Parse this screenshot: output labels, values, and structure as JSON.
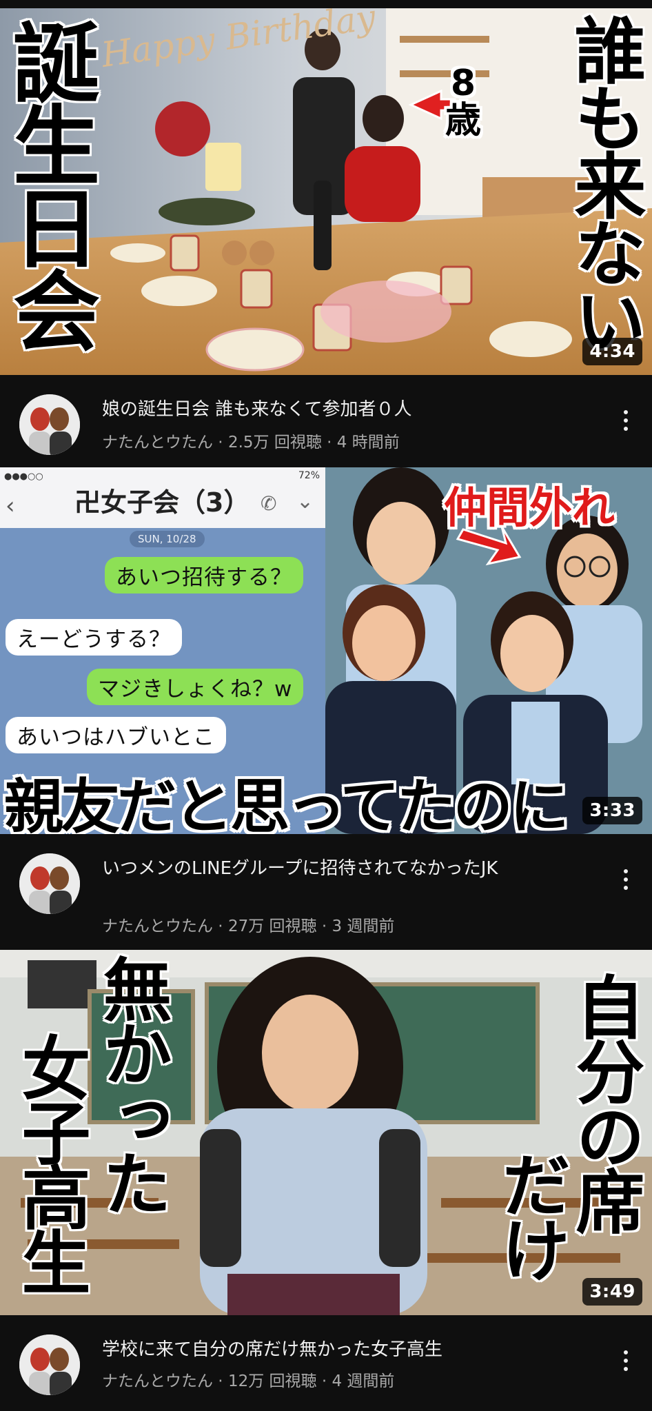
{
  "videos": [
    {
      "thumb_text_left": "誕生日会",
      "thumb_text_right": "誰も来ない",
      "thumb_age_label": "8\n歳",
      "thumb_banner": "Happy Birthday",
      "duration": "4:34",
      "title": "娘の誕生日会 誰も来なくて参加者０人",
      "channel": "ナたんとウたん",
      "views": "2.5万 回視聴",
      "age": "4 時間前"
    },
    {
      "chat_group_title": "卍女子会（3）",
      "chat_date": "SUN, 10/28",
      "chat_status_battery": "72%",
      "chat_messages": [
        {
          "side": "right",
          "text": "あいつ招待する？"
        },
        {
          "side": "left",
          "text": "えーどうする？"
        },
        {
          "side": "right",
          "text": "マジきしょくね？w"
        },
        {
          "side": "left",
          "text": "あいつはハブいとこ"
        }
      ],
      "thumb_tag": "仲間外れ",
      "thumb_caption": "親友だと思ってたのに",
      "duration": "3:33",
      "title": "いつメンのLINEグループに招待されてなかったJK",
      "channel": "ナたんとウたん",
      "views": "27万 回視聴",
      "age": "3 週間前"
    },
    {
      "thumb_text_left_a": "無かった",
      "thumb_text_left_b": "女子高生",
      "thumb_text_right_a": "自分の席",
      "thumb_text_right_b": "だけ",
      "duration": "3:49",
      "title": "学校に来て自分の席だけ無かった女子高生",
      "channel": "ナたんとウたん",
      "views": "12万 回視聴",
      "age": "4 週間前"
    }
  ],
  "separator": " · ",
  "colors": {
    "background": "#0f0f0f",
    "text_primary": "#f1f1f1",
    "text_secondary": "#aaaaaa",
    "line_green": "#8de055"
  },
  "icons": [
    "more-vert-icon",
    "phone-icon",
    "chevron-down-icon",
    "back-chevron-icon"
  ]
}
